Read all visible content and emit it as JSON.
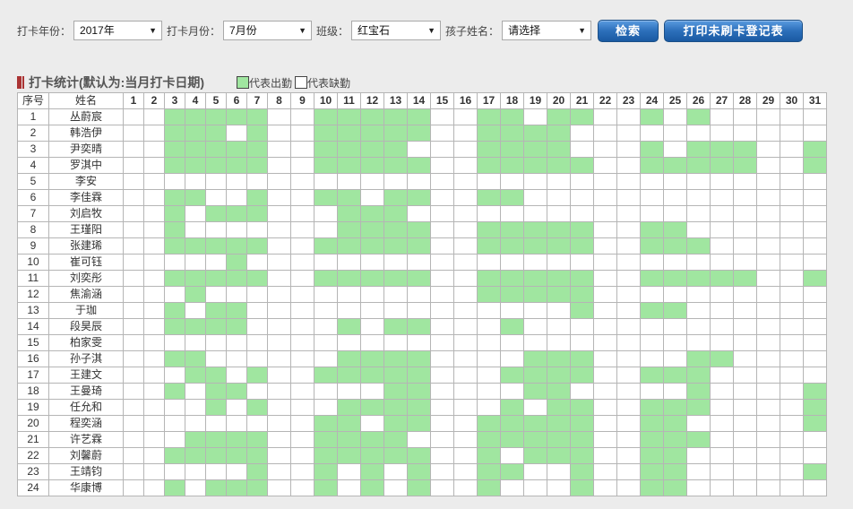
{
  "filters": {
    "year_label": "打卡年份：",
    "year_value": "2017年",
    "month_label": "打卡月份：",
    "month_value": "7月份",
    "class_label": "班级：",
    "class_value": "红宝石",
    "child_label": "孩子姓名：",
    "child_value": "请选择",
    "search_button": "检索",
    "print_button": "打印未刷卡登记表"
  },
  "stats": {
    "title": "打卡统计(默认为:当月打卡日期)",
    "legend_present": "代表出勤",
    "legend_absent": "代表缺勤",
    "present_color": "#a0e6a0",
    "absent_color": "#ffffff"
  },
  "table": {
    "col_index": "序号",
    "col_name": "姓名",
    "days": [
      "1",
      "2",
      "3",
      "4",
      "5",
      "6",
      "7",
      "8",
      "9",
      "10",
      "11",
      "12",
      "13",
      "14",
      "15",
      "16",
      "17",
      "18",
      "19",
      "20",
      "21",
      "22",
      "23",
      "24",
      "25",
      "26",
      "27",
      "28",
      "29",
      "30",
      "31"
    ],
    "rows": [
      {
        "no": "1",
        "name": "丛蔚宸",
        "present": [
          3,
          4,
          5,
          6,
          7,
          10,
          11,
          12,
          13,
          14,
          17,
          18,
          20,
          21,
          24,
          26
        ]
      },
      {
        "no": "2",
        "name": "韩浩伊",
        "present": [
          3,
          4,
          5,
          7,
          10,
          11,
          12,
          13,
          14,
          17,
          18,
          19,
          20
        ]
      },
      {
        "no": "3",
        "name": "尹奕晴",
        "present": [
          3,
          4,
          5,
          6,
          7,
          10,
          11,
          12,
          13,
          17,
          18,
          19,
          20,
          24,
          26,
          27,
          28,
          31
        ]
      },
      {
        "no": "4",
        "name": "罗淇中",
        "present": [
          3,
          4,
          5,
          6,
          7,
          10,
          11,
          12,
          13,
          14,
          17,
          18,
          19,
          20,
          21,
          24,
          25,
          26,
          27,
          28,
          31
        ]
      },
      {
        "no": "5",
        "name": "李安",
        "present": []
      },
      {
        "no": "6",
        "name": "李佳霖",
        "present": [
          3,
          4,
          7,
          10,
          11,
          13,
          14,
          17,
          18
        ]
      },
      {
        "no": "7",
        "name": "刘启牧",
        "present": [
          3,
          5,
          6,
          7,
          11,
          12,
          13
        ]
      },
      {
        "no": "8",
        "name": "王瑾阳",
        "present": [
          3,
          11,
          12,
          13,
          14,
          17,
          18,
          19,
          20,
          21,
          24,
          25
        ]
      },
      {
        "no": "9",
        "name": "张建琋",
        "present": [
          3,
          4,
          5,
          6,
          7,
          10,
          11,
          12,
          13,
          14,
          17,
          18,
          19,
          20,
          21,
          24,
          25,
          26
        ]
      },
      {
        "no": "10",
        "name": "崔可钰",
        "present": [
          6
        ]
      },
      {
        "no": "11",
        "name": "刘奕彤",
        "present": [
          3,
          4,
          5,
          6,
          7,
          10,
          11,
          12,
          13,
          14,
          17,
          18,
          19,
          20,
          21,
          24,
          25,
          26,
          27,
          28,
          31
        ]
      },
      {
        "no": "12",
        "name": "焦渝涵",
        "present": [
          4,
          17,
          18,
          19,
          20,
          21
        ]
      },
      {
        "no": "13",
        "name": "于珈",
        "present": [
          3,
          5,
          6,
          21,
          24,
          25
        ]
      },
      {
        "no": "14",
        "name": "段昊辰",
        "present": [
          3,
          4,
          5,
          6,
          11,
          13,
          14,
          18
        ]
      },
      {
        "no": "15",
        "name": "柏家雯",
        "present": []
      },
      {
        "no": "16",
        "name": "孙子淇",
        "present": [
          3,
          4,
          11,
          12,
          13,
          14,
          19,
          20,
          21,
          26,
          27
        ]
      },
      {
        "no": "17",
        "name": "王建文",
        "present": [
          4,
          5,
          7,
          10,
          11,
          12,
          13,
          14,
          18,
          19,
          20,
          21,
          24,
          25,
          26
        ]
      },
      {
        "no": "18",
        "name": "王曼琦",
        "present": [
          3,
          5,
          6,
          13,
          14,
          19,
          20,
          26,
          31
        ]
      },
      {
        "no": "19",
        "name": "任允和",
        "present": [
          5,
          7,
          11,
          12,
          13,
          14,
          18,
          20,
          21,
          24,
          25,
          26,
          31
        ]
      },
      {
        "no": "20",
        "name": "程奕涵",
        "present": [
          10,
          11,
          13,
          14,
          17,
          18,
          19,
          20,
          21,
          24,
          25,
          31
        ]
      },
      {
        "no": "21",
        "name": "许艺霖",
        "present": [
          4,
          5,
          6,
          7,
          10,
          11,
          12,
          13,
          17,
          18,
          19,
          20,
          21,
          24,
          25,
          26
        ]
      },
      {
        "no": "22",
        "name": "刘馨蔚",
        "present": [
          3,
          4,
          5,
          6,
          7,
          10,
          11,
          12,
          13,
          14,
          17,
          19,
          20,
          21,
          24,
          25
        ]
      },
      {
        "no": "23",
        "name": "王靖钧",
        "present": [
          7,
          10,
          12,
          14,
          17,
          18,
          21,
          24,
          25,
          31
        ]
      },
      {
        "no": "24",
        "name": "华康博",
        "present": [
          3,
          5,
          6,
          7,
          10,
          12,
          14,
          17,
          21,
          24,
          25
        ]
      }
    ]
  }
}
